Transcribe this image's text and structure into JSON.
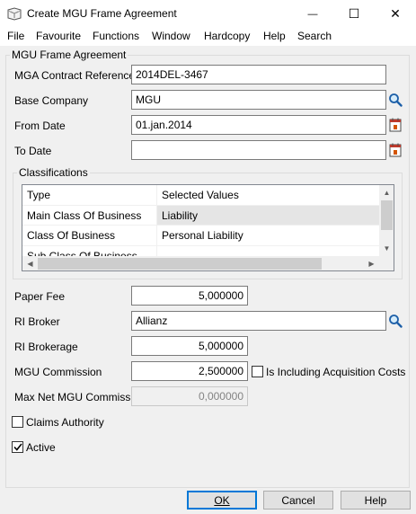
{
  "window": {
    "title": "Create MGU Frame Agreement",
    "minimize_glyph": "—",
    "maximize_glyph": "☐",
    "close_glyph": "✕"
  },
  "menu": [
    "File",
    "Favourite",
    "Functions",
    "Window",
    "Hardcopy",
    "Help",
    "Search"
  ],
  "group": {
    "label": "MGU Frame Agreement"
  },
  "fields": {
    "mga_ref": {
      "label": "MGA Contract Reference",
      "value": "2014DEL-3467"
    },
    "base_company": {
      "label": "Base Company",
      "value": "MGU"
    },
    "from_date": {
      "label": "From Date",
      "value": "01.jan.2014"
    },
    "to_date": {
      "label": "To Date",
      "value": ""
    },
    "paper_fee": {
      "label": "Paper Fee",
      "value": "5,000000"
    },
    "ri_broker": {
      "label": "RI Broker",
      "value": "Allianz"
    },
    "ri_brokerage": {
      "label": "RI Brokerage",
      "value": "5,000000"
    },
    "mgu_commission": {
      "label": "MGU Commission",
      "value": "2,500000"
    },
    "max_net_mgu_commission": {
      "label": "Max Net MGU Commission",
      "value": "0,000000"
    }
  },
  "classifications": {
    "label": "Classifications",
    "columns": [
      "Type",
      "Selected Values"
    ],
    "rows": [
      [
        "Main Class Of Business",
        "Liability"
      ],
      [
        "Class Of Business",
        "Personal Liability"
      ],
      [
        "Sub Class Of Business",
        ""
      ]
    ],
    "selected_row": 0
  },
  "checks": {
    "is_including_acq": {
      "label": "Is Including Acquisition Costs",
      "checked": false
    },
    "claims_authority": {
      "label": "Claims Authority",
      "checked": false
    },
    "active": {
      "label": "Active",
      "checked": true
    }
  },
  "buttons": {
    "ok": "OK",
    "cancel": "Cancel",
    "help": "Help"
  },
  "icons": {
    "search": "magnifier-icon",
    "calendar": "calendar-icon"
  }
}
